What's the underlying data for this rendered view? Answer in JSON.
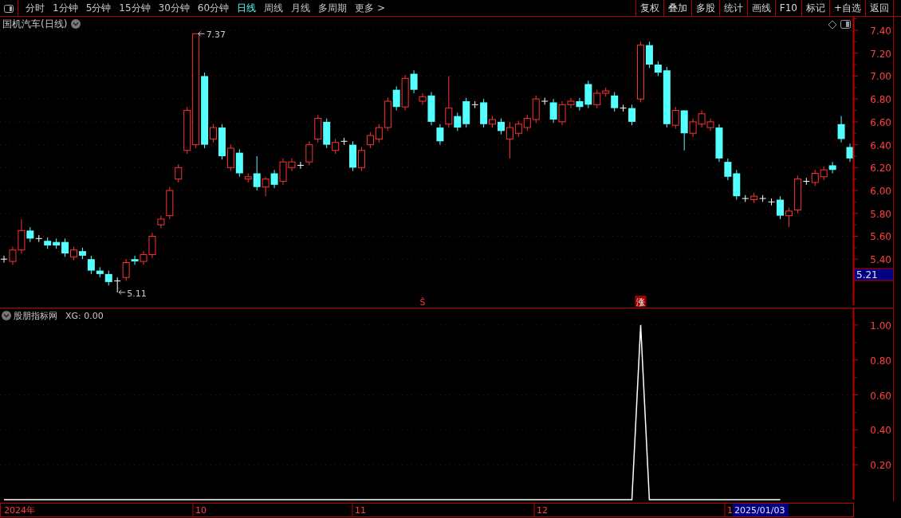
{
  "toolbar": {
    "periods": [
      {
        "label": "分时",
        "selected": false
      },
      {
        "label": "1分钟",
        "selected": false
      },
      {
        "label": "5分钟",
        "selected": false
      },
      {
        "label": "15分钟",
        "selected": false
      },
      {
        "label": "30分钟",
        "selected": false
      },
      {
        "label": "60分钟",
        "selected": false
      },
      {
        "label": "日线",
        "selected": true
      },
      {
        "label": "周线",
        "selected": false
      },
      {
        "label": "月线",
        "selected": false
      },
      {
        "label": "多周期",
        "selected": false
      },
      {
        "label": "更多 >",
        "selected": false
      }
    ],
    "buttons": [
      "复权",
      "叠加",
      "多股",
      "统计",
      "画线",
      "F10",
      "标记",
      "+自选",
      "返回"
    ]
  },
  "main_chart": {
    "title": "国机汽车(日线)",
    "price_axis": [
      "7.40",
      "7.20",
      "7.00",
      "6.80",
      "6.60",
      "6.40",
      "6.20",
      "6.00",
      "5.80",
      "5.60",
      "5.40"
    ],
    "current_price": "5.21",
    "annotations": [
      {
        "kind": "high",
        "text": "7.37"
      },
      {
        "kind": "low",
        "text": "5.11"
      }
    ],
    "signals": [
      {
        "kind": "sell",
        "text": "Ŝ"
      },
      {
        "kind": "rise",
        "text": "涨"
      }
    ]
  },
  "indicator": {
    "name": "股朋指标网",
    "value_label": ": 0.00",
    "chart_data": {
      "type": "line",
      "grid": true,
      "ylim": [
        0,
        1.1
      ],
      "yticks": [
        {
          "value": 1,
          "label": "1.00"
        },
        {
          "value": 0.8,
          "label": "0.80"
        },
        {
          "value": 0.6,
          "label": "0.60"
        },
        {
          "value": 0.4,
          "label": "0.40"
        },
        {
          "value": 0.2,
          "label": "0.20"
        }
      ],
      "series": [
        {
          "name": "XG",
          "color": "#ffffff",
          "values": [
            0,
            0,
            0,
            0,
            0,
            0,
            0,
            0,
            0,
            0,
            0,
            0,
            0,
            0,
            0,
            0,
            0,
            0,
            0,
            0,
            0,
            0,
            0,
            0,
            0,
            0,
            0,
            0,
            0,
            0,
            0,
            0,
            0,
            0,
            0,
            0,
            0,
            0,
            0,
            0,
            0,
            0,
            0,
            0,
            0,
            0,
            0,
            0,
            0,
            0,
            0,
            0,
            0,
            0,
            0,
            0,
            0,
            0,
            0,
            0,
            0,
            0,
            0,
            0,
            0,
            0,
            0,
            0,
            0,
            0,
            0,
            0,
            0,
            1,
            0,
            0,
            0,
            0,
            0,
            0,
            0,
            0,
            0,
            0,
            0,
            0,
            0,
            0,
            0,
            0,
            null,
            null,
            null,
            null,
            null,
            null,
            null,
            null
          ]
        }
      ]
    }
  },
  "date_axis": {
    "labels": [
      "2024年",
      "10",
      "11",
      "12",
      "1"
    ],
    "cursor_date": "2025/01/03"
  }
}
